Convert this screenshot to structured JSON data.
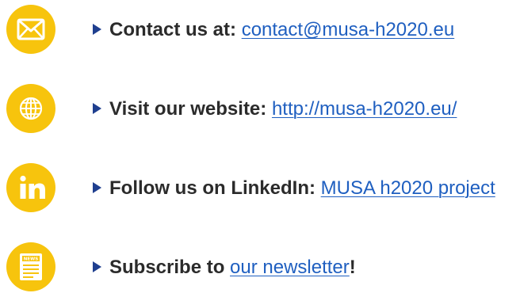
{
  "colors": {
    "icon_circle": "#f7c40d",
    "bullet": "#1f3f8f",
    "link": "#1f5fc0",
    "text": "#2b2b2b"
  },
  "items": [
    {
      "icon": "envelope-icon",
      "label": "Contact us at:",
      "link_text": "contact@musa-h2020.eu",
      "suffix": ""
    },
    {
      "icon": "globe-icon",
      "label": "Visit our website:",
      "link_text": "http://musa-h2020.eu/",
      "suffix": ""
    },
    {
      "icon": "linkedin-icon",
      "label": "Follow us on LinkedIn:",
      "link_text": "MUSA h2020 project",
      "suffix": ""
    },
    {
      "icon": "newsletter-icon",
      "label": "Subscribe to",
      "link_text": "our newsletter",
      "suffix": "!",
      "badge": "NEWS"
    }
  ]
}
